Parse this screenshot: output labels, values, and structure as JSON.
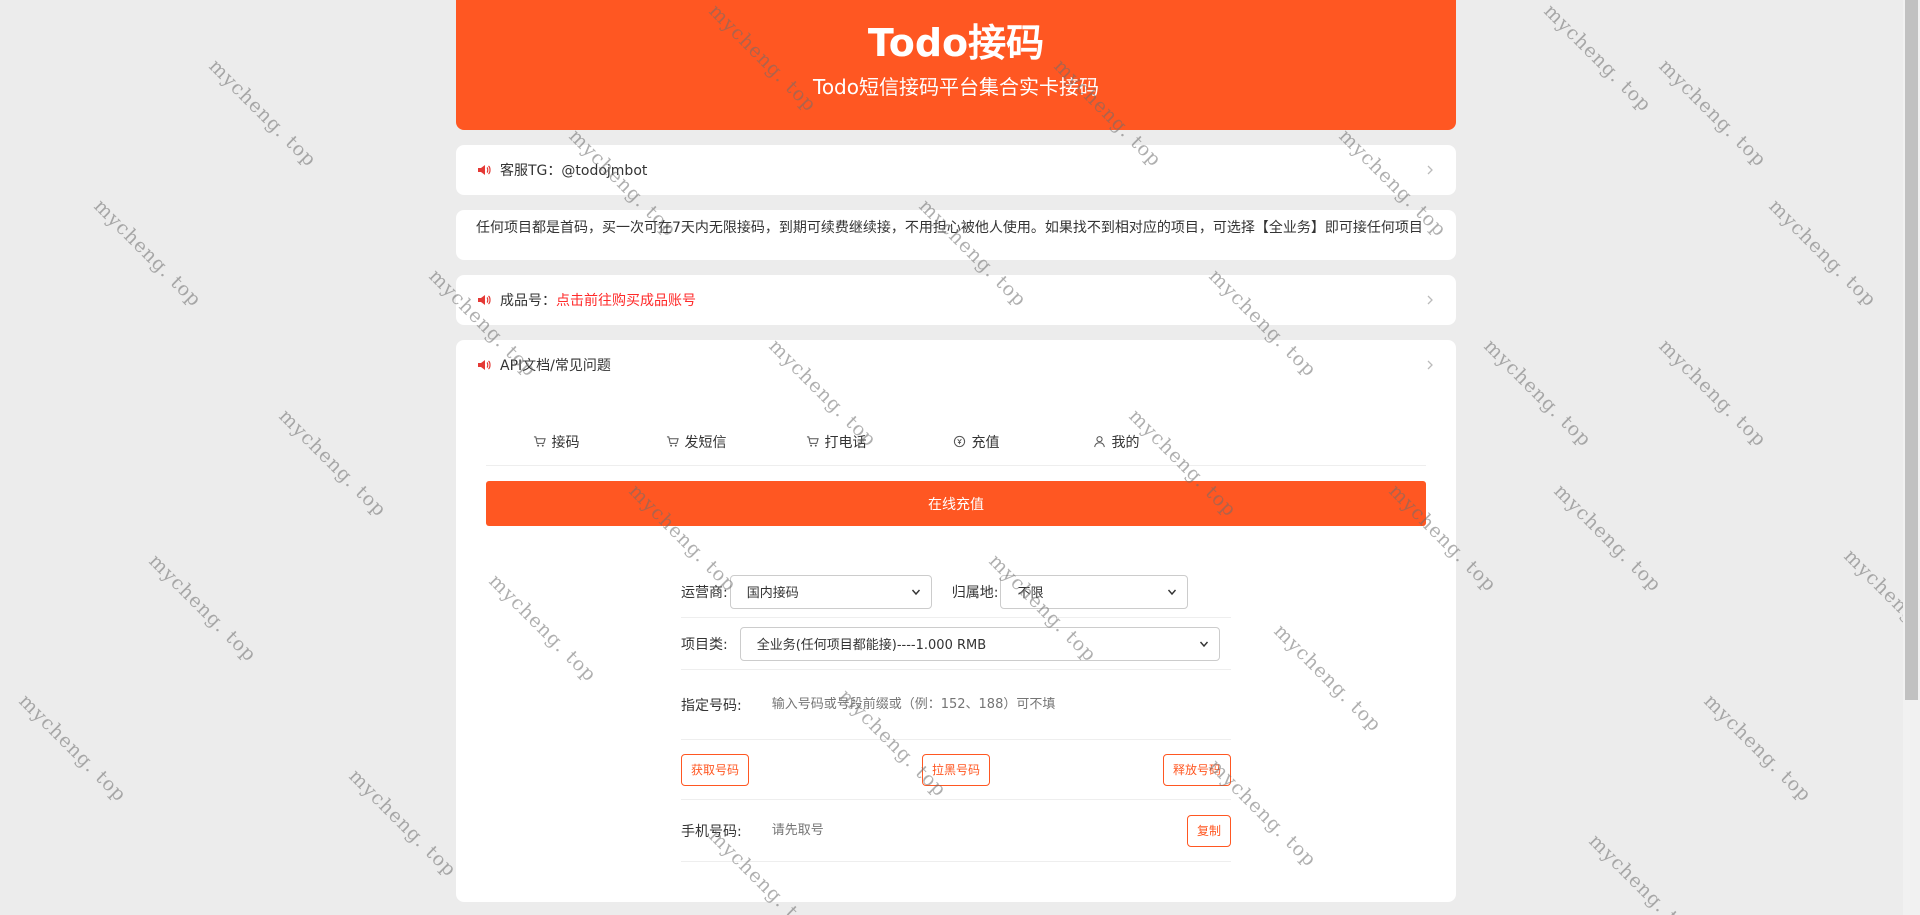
{
  "header": {
    "title": "Todo接码",
    "subtitle": "Todo短信接码平台集合实卡接码"
  },
  "notices": {
    "support": "客服TG：@todojmbot",
    "description": "任何项目都是首码，买一次可在7天内无限接码，到期可续费继续接，不用担心被他人使用。如果找不到相对应的项目，可选择【全业务】即可接任何项目",
    "finished_label": "成品号：",
    "finished_link": "点击前往购买成品账号",
    "api_docs": "API文档/常见问题"
  },
  "tabs": [
    {
      "label": "接码",
      "icon": "cart-icon"
    },
    {
      "label": "发短信",
      "icon": "cart-icon"
    },
    {
      "label": "打电话",
      "icon": "cart-icon"
    },
    {
      "label": "充值",
      "icon": "yuan-circle-icon"
    },
    {
      "label": "我的",
      "icon": "user-icon"
    }
  ],
  "recharge_button": "在线充值",
  "form": {
    "operator_label": "运营商:",
    "operator_value": "国内接码",
    "region_label": "归属地:",
    "region_value": "不限",
    "project_label": "项目类:",
    "project_value": "全业务(任何项目都能接)----1.000 RMB",
    "number_label": "指定号码:",
    "number_placeholder": "输入号码或号段前缀或（例：152、188）可不填",
    "get_number": "获取号码",
    "blacklist_number": "拉黑号码",
    "release_number": "释放号码",
    "phone_label": "手机号码:",
    "phone_placeholder": "请先取号",
    "copy": "复制"
  },
  "watermark": "mycheng. top",
  "colors": {
    "accent": "#ff5722",
    "link_red": "#ff2a2a",
    "background": "#ececec"
  }
}
